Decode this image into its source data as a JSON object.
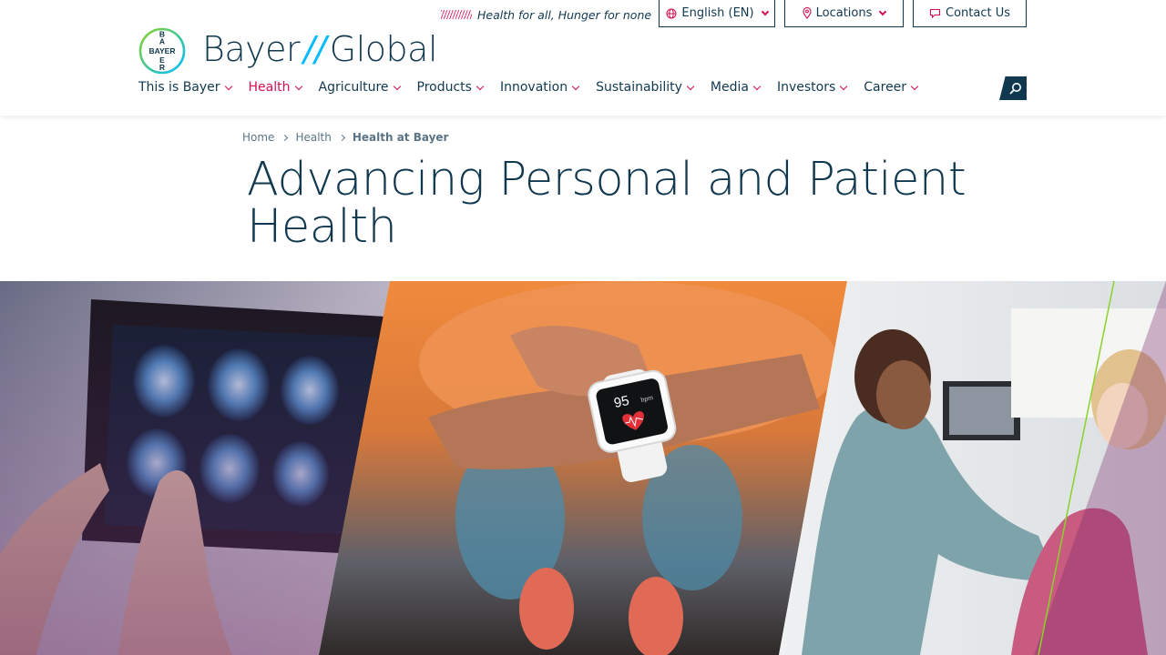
{
  "topbar": {
    "tagline": "Health for all, Hunger for none",
    "language_label": "English (EN)",
    "locations_label": "Locations",
    "contact_label": "Contact Us"
  },
  "brand": {
    "logo_text": "BAYER",
    "name_part1": "Bayer",
    "slash": "//",
    "name_part2": "Global"
  },
  "nav": {
    "items": [
      {
        "label": "This is Bayer"
      },
      {
        "label": "Health"
      },
      {
        "label": "Agriculture"
      },
      {
        "label": "Products"
      },
      {
        "label": "Innovation"
      },
      {
        "label": "Sustainability"
      },
      {
        "label": "Media"
      },
      {
        "label": "Investors"
      },
      {
        "label": "Career"
      }
    ],
    "active_index": 1
  },
  "breadcrumb": {
    "items": [
      "Home",
      "Health",
      "Health at Bayer"
    ]
  },
  "page": {
    "title": "Advancing Personal and Patient Health"
  },
  "hero": {
    "watch_reading": "95",
    "watch_unit": "bpm"
  },
  "colors": {
    "primary": "#10384f",
    "accent": "#d30f4b",
    "brand_blue": "#00bcff",
    "brand_green": "#89d329"
  },
  "icons": {
    "language": "globe-icon",
    "locations": "map-pin-icon",
    "contact": "chat-bubble-icon",
    "search": "search-icon"
  }
}
